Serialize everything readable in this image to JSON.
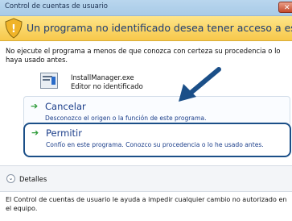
{
  "window": {
    "title": "Control de cuentas de usuario",
    "close_label": "✕"
  },
  "banner": {
    "message": "Un programa no identificado desea tener acceso a este equipo"
  },
  "intro": "No ejecute el programa a menos de que conozca con certeza su procedencia o lo haya usado antes.",
  "app": {
    "name": "InstallManager.exe",
    "publisher": "Editor no identificado"
  },
  "options": {
    "cancel": {
      "label": "Cancelar",
      "description": "Desconozco el origen o la función de este programa."
    },
    "allow": {
      "label": "Permitir",
      "description": "Confío en este programa. Conozco su procedencia o lo he usado antes."
    }
  },
  "details": {
    "label": "Detalles"
  },
  "footer": "El Control de cuentas de usuario le ayuda a impedir cualquier cambio no autorizado en el equipo.",
  "colors": {
    "accent": "#1b4f88",
    "link": "#1b3e8a",
    "banner": "#f7c84a",
    "arrow": "#2f9c3a"
  }
}
